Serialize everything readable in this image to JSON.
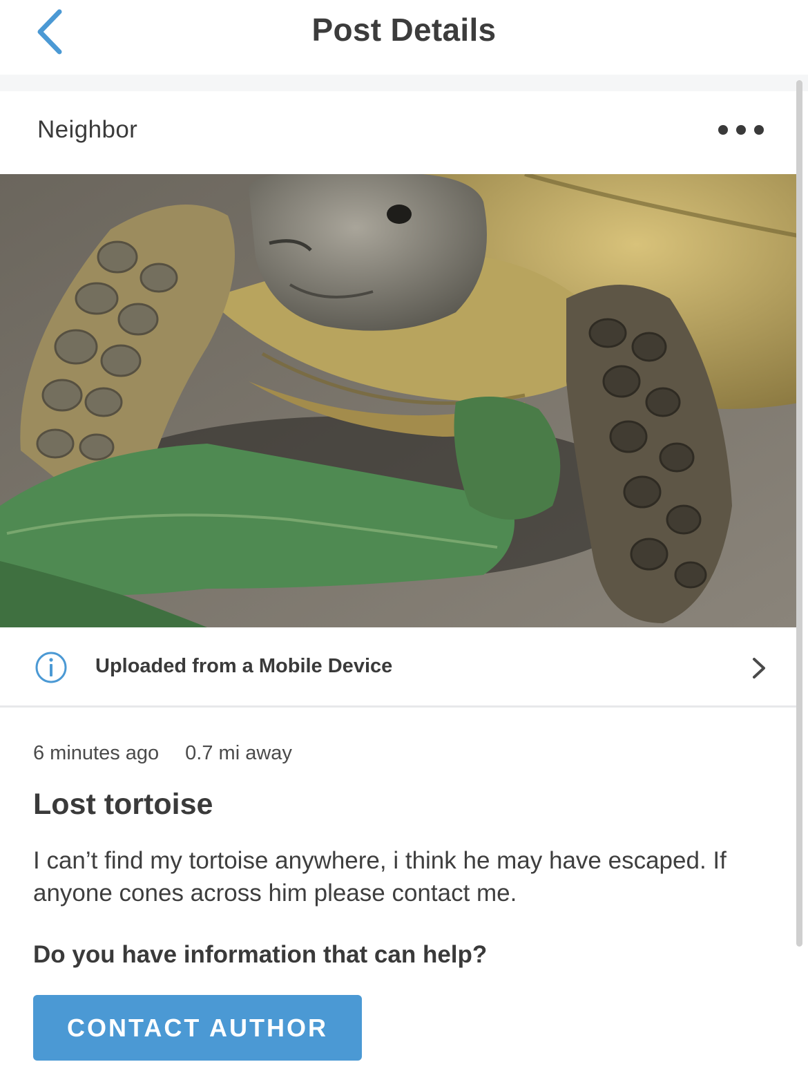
{
  "header": {
    "title": "Post Details",
    "back_icon": "chevron-left-icon"
  },
  "author": {
    "name": "Neighbor",
    "more_icon": "more-dots-icon"
  },
  "photo": {
    "description_icon": "post-photo"
  },
  "upload_info": {
    "label": "Uploaded from a Mobile Device",
    "icon": "info-icon",
    "chevron": "chevron-right-icon"
  },
  "post": {
    "time_ago": "6 minutes ago",
    "distance": "0.7 mi away",
    "title": "Lost tortoise",
    "body": "I can’t find my tortoise anywhere, i think he may have escaped. If anyone cones across him please contact me.",
    "help_question": "Do you have information that can help?",
    "contact_button": "CONTACT AUTHOR"
  },
  "colors": {
    "accent": "#4b99d4",
    "text": "#3a3a3a",
    "separator": "#e7e8ea"
  }
}
